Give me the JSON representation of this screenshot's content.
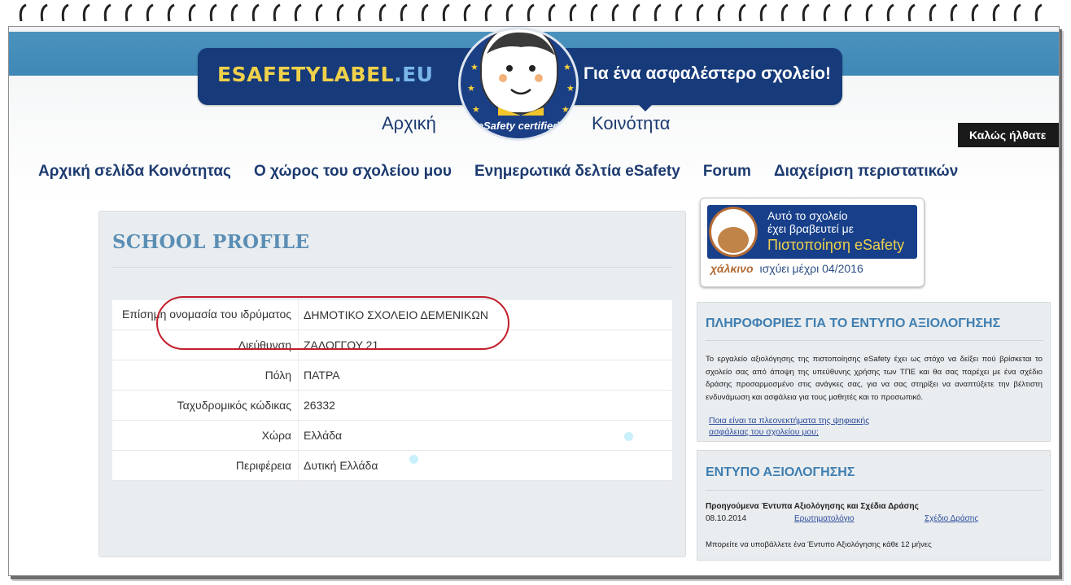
{
  "header": {
    "logo_text": "ESAFETYLABEL",
    "logo_suffix": ".EU",
    "tagline": "Για ένα ασφαλέστερο σχολείο!",
    "badge_text": "eSafety certified",
    "link_home": "Αρχική",
    "link_community": "Κοινότητα",
    "welcome": "Καλώς ήλθατε"
  },
  "nav": [
    {
      "label": "Αρχική σελίδα Κοινότητας"
    },
    {
      "label": "Ο χώρος του σχολείου μου"
    },
    {
      "label": "Ενημερωτικά δελτία eSafety"
    },
    {
      "label": "Forum"
    },
    {
      "label": "Διαχείριση περιστατικών"
    }
  ],
  "profile": {
    "title": "SCHOOL PROFILE",
    "rows": [
      {
        "key": "Επίσημη ονομασία του ιδρύματος",
        "value": "ΔΗΜΟΤΙΚΟ ΣΧΟΛΕΙΟ ΔΕΜΕΝΙΚΩΝ"
      },
      {
        "key": "Διεύθυνση",
        "value": "ΖΑΛΟΓΓΟΥ 21"
      },
      {
        "key": "Πόλη",
        "value": "ΠΑΤΡΑ"
      },
      {
        "key": "Ταχυδρομικός κώδικας",
        "value": "26332"
      },
      {
        "key": "Χώρα",
        "value": "Ελλάδα"
      },
      {
        "key": "Περιφέρεια",
        "value": "Δυτική Ελλάδα"
      }
    ]
  },
  "certificate": {
    "line1": "Αυτό το σχολείο",
    "line2": "έχει βραβευτεί με",
    "line3": "Πιστοποίηση eSafety",
    "level": "χάλκινο",
    "valid": "ισχύει μέχρι 04/2016"
  },
  "info": {
    "title": "ΠΛΗΡΟΦΟΡΙΕΣ ΓΙΑ ΤΟ ΕΝΤΥΠΟ ΑΞΙΟΛΟΓΗΣΗΣ",
    "text": "Το εργαλείο αξιολόγησης της πιστοποίησης eSafety έχει ως στόχο να δείξει πού βρίσκεται το σχολείο σας από άποψη της υπεύθυνης χρήσης των ΤΠΕ και θα σας παρέχει με ένα σχέδιο δράσης προσαρμοσμένο στις ανάγκες σας, για να σας στηρίξει να αναπτύξετε την βέλτιστη ενδυνάμωση και ασφάλεια για τους μαθητές και το προσωπικό.",
    "link_line1": "Ποια είναι τα πλεονεκτήματα της ψηφιακής",
    "link_line2": "ασφάλειας του σχολείου μου;"
  },
  "form": {
    "title": "ΕΝΤΥΠΟ ΑΞΙΟΛΟΓΗΣΗΣ",
    "heading": "Προηγούμενα Έντυπα Αξιολόγησης και Σχέδια Δράσης",
    "date": "08.10.2014",
    "questionnaire": "Ερωτηματολόγιο",
    "action_plan": "Σχέδιο Δράσης",
    "note": "Μπορείτε να υποβάλλετε ένα Έντυπο Αξιολόγησης κάθε 12 μήνες"
  }
}
